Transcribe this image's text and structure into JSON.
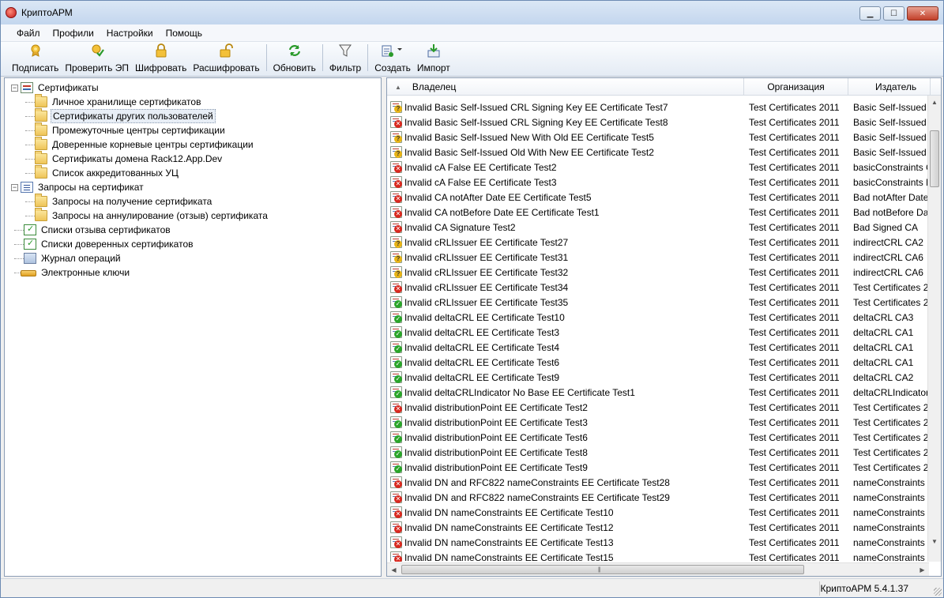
{
  "window": {
    "title": "КриптоАРМ"
  },
  "menu": [
    "Файл",
    "Профили",
    "Настройки",
    "Помощь"
  ],
  "toolbar": {
    "sign": "Подписать",
    "verify": "Проверить ЭП",
    "encrypt": "Шифровать",
    "decrypt": "Расшифровать",
    "refresh": "Обновить",
    "filter": "Фильтр",
    "create": "Создать",
    "import": "Импорт"
  },
  "tree": [
    {
      "label": "Сертификаты",
      "level": 0,
      "expander": "−",
      "icon": "certificates-icon"
    },
    {
      "label": "Личное хранилище сертификатов",
      "level": 1,
      "icon": "folder-icon"
    },
    {
      "label": "Сертификаты других пользователей",
      "level": 1,
      "icon": "folder-icon",
      "selected": true
    },
    {
      "label": "Промежуточные центры сертификации",
      "level": 1,
      "icon": "folder-icon"
    },
    {
      "label": "Доверенные корневые центры сертификации",
      "level": 1,
      "icon": "folder-icon"
    },
    {
      "label": "Сертификаты домена Rack12.App.Dev",
      "level": 1,
      "icon": "folder-icon"
    },
    {
      "label": "Список аккредитованных УЦ",
      "level": 1,
      "icon": "folder-icon"
    },
    {
      "label": "Запросы на сертификат",
      "level": 0,
      "expander": "−",
      "icon": "requests-icon"
    },
    {
      "label": "Запросы на получение сертификата",
      "level": 1,
      "icon": "folder-icon"
    },
    {
      "label": "Запросы на аннулирование (отзыв) сертификата",
      "level": 1,
      "icon": "folder-icon"
    },
    {
      "label": "Списки отзыва сертификатов",
      "level": 0,
      "icon": "crl-icon"
    },
    {
      "label": "Списки доверенных сертификатов",
      "level": 0,
      "icon": "ctl-icon"
    },
    {
      "label": "Журнал операций",
      "level": 0,
      "icon": "journal-icon"
    },
    {
      "label": "Электронные ключи",
      "level": 0,
      "icon": "key-icon"
    }
  ],
  "list": {
    "columns": {
      "owner": "Владелец",
      "org": "Организация",
      "issuer": "Издатель"
    },
    "status_colors": {
      "valid": "#2aa52a",
      "invalid": "#d8281e",
      "unknown": "#e7b416"
    },
    "rows": [
      {
        "status": "unknown",
        "owner": "Invalid Basic Self-Issued CRL Signing Key EE Certificate Test7",
        "org": "Test Certificates 2011",
        "issuer": "Basic Self-Issued C"
      },
      {
        "status": "invalid",
        "owner": "Invalid Basic Self-Issued CRL Signing Key EE Certificate Test8",
        "org": "Test Certificates 2011",
        "issuer": "Basic Self-Issued C"
      },
      {
        "status": "unknown",
        "owner": "Invalid Basic Self-Issued New With Old EE Certificate Test5",
        "org": "Test Certificates 2011",
        "issuer": "Basic Self-Issued C"
      },
      {
        "status": "unknown",
        "owner": "Invalid Basic Self-Issued Old With New EE Certificate Test2",
        "org": "Test Certificates 2011",
        "issuer": "Basic Self-Issued N"
      },
      {
        "status": "invalid",
        "owner": "Invalid cA False EE Certificate Test2",
        "org": "Test Certificates 2011",
        "issuer": "basicConstraints C"
      },
      {
        "status": "invalid",
        "owner": "Invalid cA False EE Certificate Test3",
        "org": "Test Certificates 2011",
        "issuer": "basicConstraints N"
      },
      {
        "status": "invalid",
        "owner": "Invalid CA notAfter Date EE Certificate Test5",
        "org": "Test Certificates 2011",
        "issuer": "Bad notAfter Date"
      },
      {
        "status": "invalid",
        "owner": "Invalid CA notBefore Date EE Certificate Test1",
        "org": "Test Certificates 2011",
        "issuer": "Bad notBefore Dat"
      },
      {
        "status": "invalid",
        "owner": "Invalid CA Signature Test2",
        "org": "Test Certificates 2011",
        "issuer": "Bad Signed CA"
      },
      {
        "status": "unknown",
        "owner": "Invalid cRLIssuer EE Certificate Test27",
        "org": "Test Certificates 2011",
        "issuer": "indirectCRL CA2"
      },
      {
        "status": "unknown",
        "owner": "Invalid cRLIssuer EE Certificate Test31",
        "org": "Test Certificates 2011",
        "issuer": "indirectCRL CA6"
      },
      {
        "status": "unknown",
        "owner": "Invalid cRLIssuer EE Certificate Test32",
        "org": "Test Certificates 2011",
        "issuer": "indirectCRL CA6"
      },
      {
        "status": "invalid",
        "owner": "Invalid cRLIssuer EE Certificate Test34",
        "org": "Test Certificates 2011",
        "issuer": "Test Certificates 2"
      },
      {
        "status": "valid",
        "owner": "Invalid cRLIssuer EE Certificate Test35",
        "org": "Test Certificates 2011",
        "issuer": "Test Certificates 2"
      },
      {
        "status": "valid",
        "owner": "Invalid deltaCRL EE Certificate Test10",
        "org": "Test Certificates 2011",
        "issuer": "deltaCRL CA3"
      },
      {
        "status": "valid",
        "owner": "Invalid deltaCRL EE Certificate Test3",
        "org": "Test Certificates 2011",
        "issuer": "deltaCRL CA1"
      },
      {
        "status": "valid",
        "owner": "Invalid deltaCRL EE Certificate Test4",
        "org": "Test Certificates 2011",
        "issuer": "deltaCRL CA1"
      },
      {
        "status": "valid",
        "owner": "Invalid deltaCRL EE Certificate Test6",
        "org": "Test Certificates 2011",
        "issuer": "deltaCRL CA1"
      },
      {
        "status": "valid",
        "owner": "Invalid deltaCRL EE Certificate Test9",
        "org": "Test Certificates 2011",
        "issuer": "deltaCRL CA2"
      },
      {
        "status": "valid",
        "owner": "Invalid deltaCRLIndicator No Base EE Certificate Test1",
        "org": "Test Certificates 2011",
        "issuer": "deltaCRLIndicator"
      },
      {
        "status": "invalid",
        "owner": "Invalid distributionPoint EE Certificate Test2",
        "org": "Test Certificates 2011",
        "issuer": "Test Certificates 2"
      },
      {
        "status": "valid",
        "owner": "Invalid distributionPoint EE Certificate Test3",
        "org": "Test Certificates 2011",
        "issuer": "Test Certificates 2"
      },
      {
        "status": "valid",
        "owner": "Invalid distributionPoint EE Certificate Test6",
        "org": "Test Certificates 2011",
        "issuer": "Test Certificates 2"
      },
      {
        "status": "valid",
        "owner": "Invalid distributionPoint EE Certificate Test8",
        "org": "Test Certificates 2011",
        "issuer": "Test Certificates 2"
      },
      {
        "status": "valid",
        "owner": "Invalid distributionPoint EE Certificate Test9",
        "org": "Test Certificates 2011",
        "issuer": "Test Certificates 2"
      },
      {
        "status": "invalid",
        "owner": "Invalid DN and RFC822 nameConstraints EE Certificate Test28",
        "org": "Test Certificates 2011",
        "issuer": "nameConstraints"
      },
      {
        "status": "invalid",
        "owner": "Invalid DN and RFC822 nameConstraints EE Certificate Test29",
        "org": "Test Certificates 2011",
        "issuer": "nameConstraints"
      },
      {
        "status": "invalid",
        "owner": "Invalid DN nameConstraints EE Certificate Test10",
        "org": "Test Certificates 2011",
        "issuer": "nameConstraints"
      },
      {
        "status": "invalid",
        "owner": "Invalid DN nameConstraints EE Certificate Test12",
        "org": "Test Certificates 2011",
        "issuer": "nameConstraints"
      },
      {
        "status": "invalid",
        "owner": "Invalid DN nameConstraints EE Certificate Test13",
        "org": "Test Certificates 2011",
        "issuer": "nameConstraints"
      },
      {
        "status": "invalid",
        "owner": "Invalid DN nameConstraints EE Certificate Test15",
        "org": "Test Certificates 2011",
        "issuer": "nameConstraints"
      }
    ]
  },
  "statusbar": {
    "version": "КриптоАРМ 5.4.1.37"
  }
}
